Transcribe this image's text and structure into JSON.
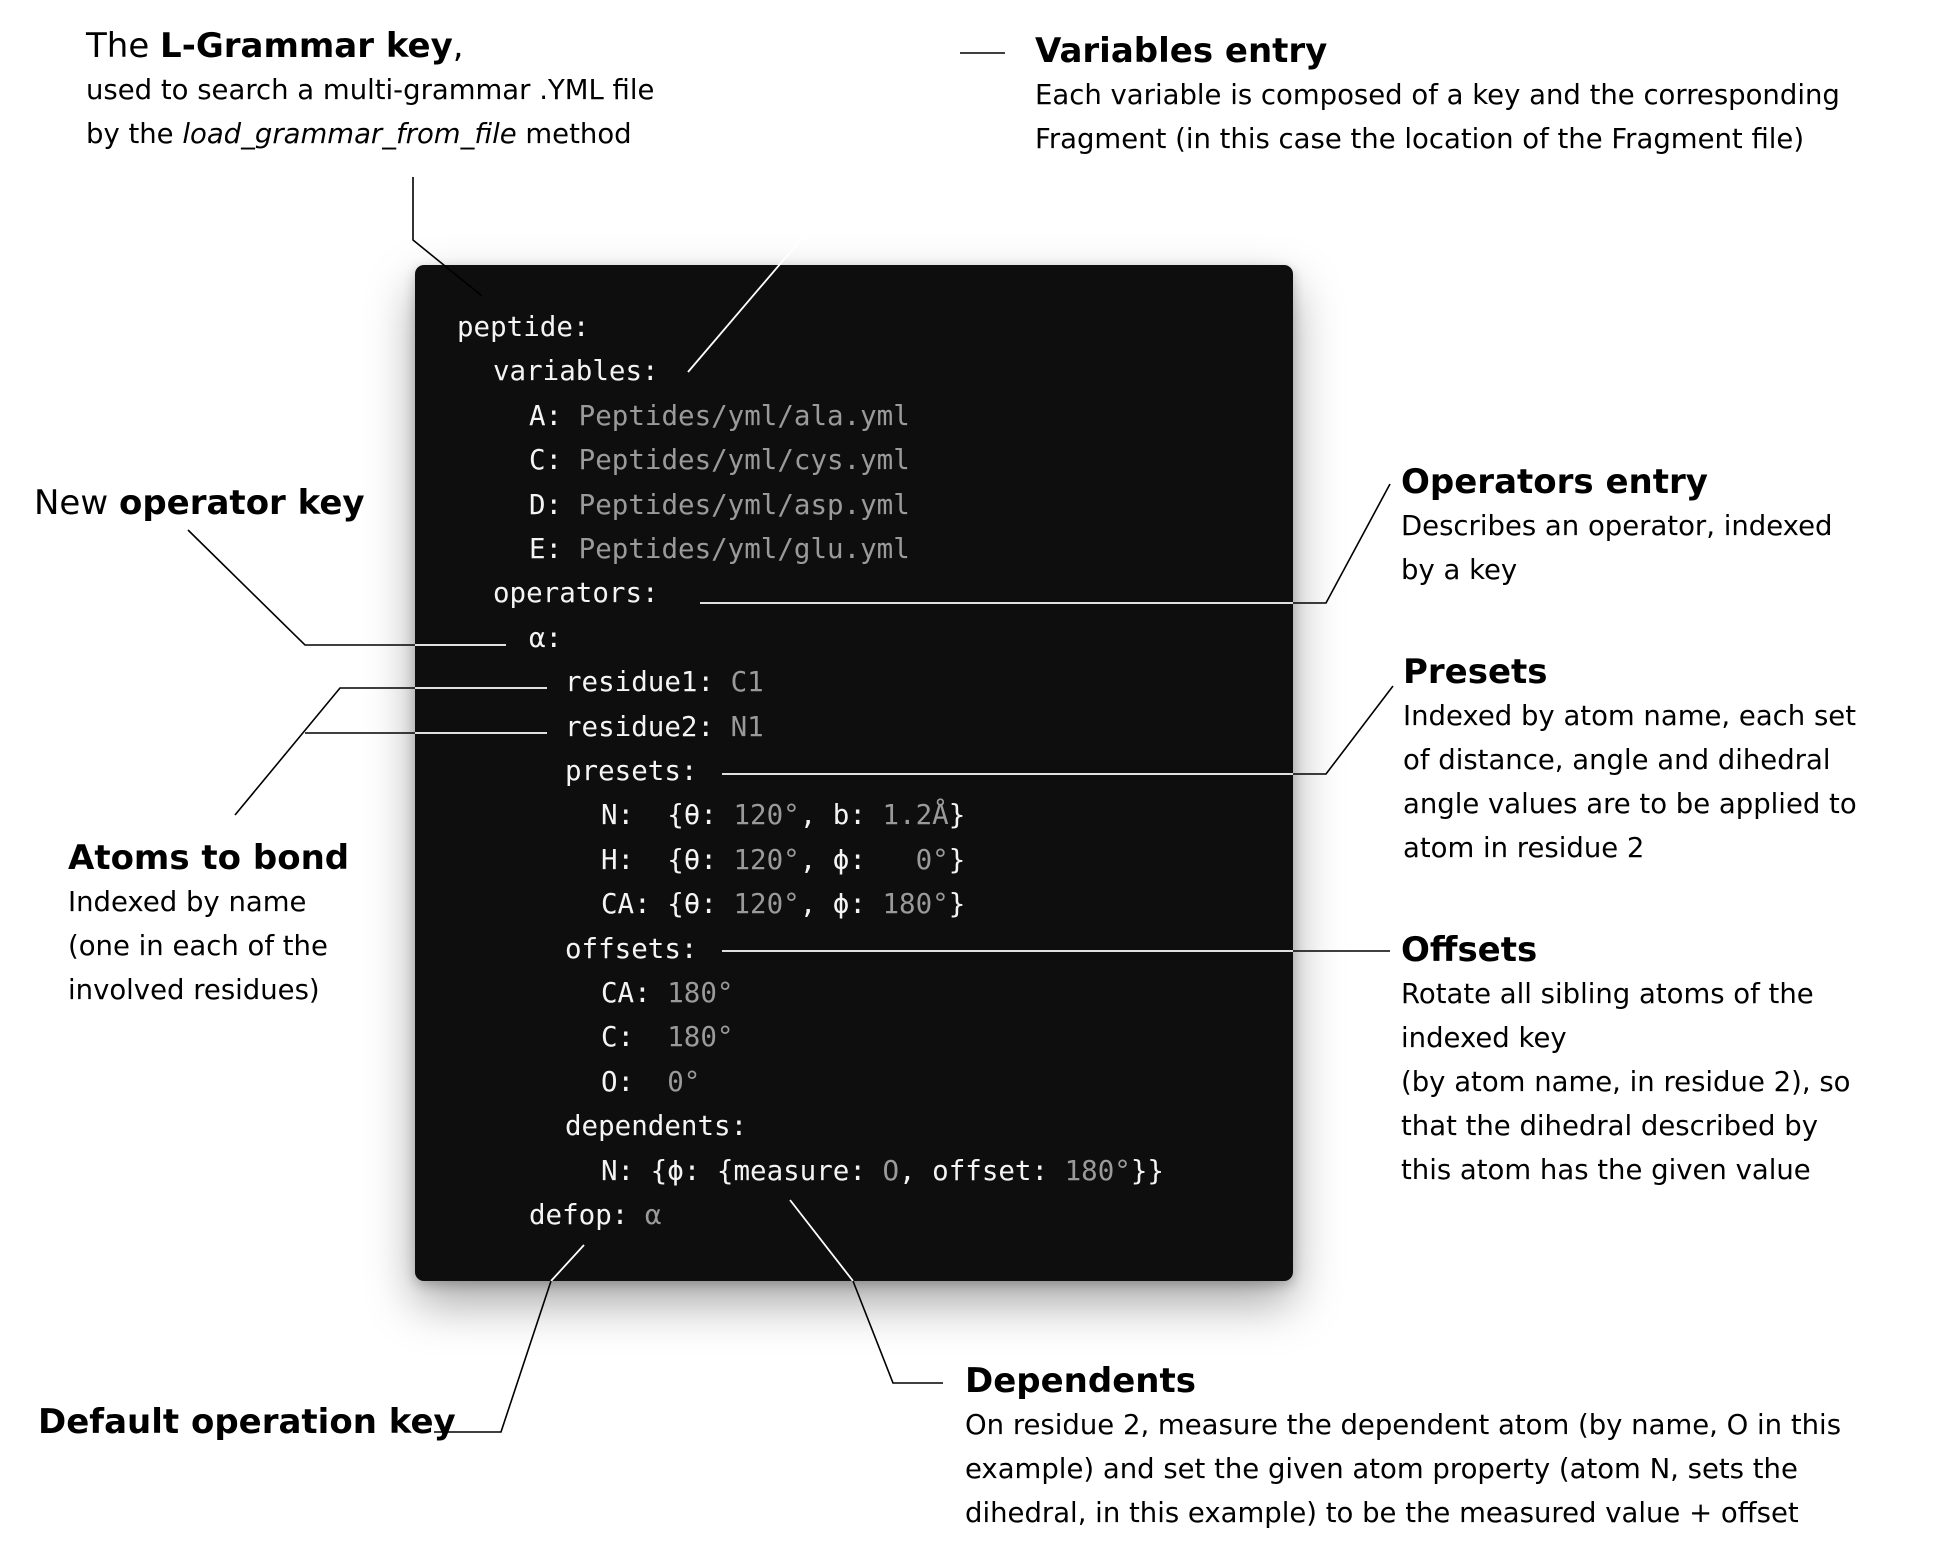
{
  "code": {
    "lines": [
      {
        "indent": 0,
        "key": "peptide:",
        "value": ""
      },
      {
        "indent": 1,
        "key": "variables:",
        "value": ""
      },
      {
        "indent": 2,
        "key": "A: ",
        "value": "Peptides/yml/ala.yml"
      },
      {
        "indent": 2,
        "key": "C: ",
        "value": "Peptides/yml/cys.yml"
      },
      {
        "indent": 2,
        "key": "D: ",
        "value": "Peptides/yml/asp.yml"
      },
      {
        "indent": 2,
        "key": "E: ",
        "value": "Peptides/yml/glu.yml"
      },
      {
        "indent": 1,
        "key": "operators:",
        "value": ""
      },
      {
        "indent": 2,
        "key": "α:",
        "value": ""
      },
      {
        "indent": 3,
        "key": "residue1: ",
        "value": "C1"
      },
      {
        "indent": 3,
        "key": "residue2: ",
        "value": "N1"
      },
      {
        "indent": 3,
        "key": "presets:",
        "value": ""
      },
      {
        "indent": 4,
        "segments": [
          [
            "k",
            "N:  {θ: "
          ],
          [
            "v",
            "120°"
          ],
          [
            "k",
            ", b: "
          ],
          [
            "v",
            "1.2Å"
          ],
          [
            "k",
            "}"
          ]
        ]
      },
      {
        "indent": 4,
        "segments": [
          [
            "k",
            "H:  {θ: "
          ],
          [
            "v",
            "120°"
          ],
          [
            "k",
            ", ϕ: "
          ],
          [
            "v",
            "  0°"
          ],
          [
            "k",
            "}"
          ]
        ]
      },
      {
        "indent": 4,
        "segments": [
          [
            "k",
            "CA: {θ: "
          ],
          [
            "v",
            "120°"
          ],
          [
            "k",
            ", ϕ: "
          ],
          [
            "v",
            "180°"
          ],
          [
            "k",
            "}"
          ]
        ]
      },
      {
        "indent": 3,
        "key": "offsets:",
        "value": ""
      },
      {
        "indent": 4,
        "key": "CA: ",
        "value": "180°"
      },
      {
        "indent": 4,
        "key": "C:  ",
        "value": "180°"
      },
      {
        "indent": 4,
        "key": "O:  ",
        "value": "0°"
      },
      {
        "indent": 3,
        "key": "dependents:",
        "value": ""
      },
      {
        "indent": 4,
        "segments": [
          [
            "k",
            "N: {ϕ: {measure: "
          ],
          [
            "v",
            "O"
          ],
          [
            "k",
            ", offset: "
          ],
          [
            "v",
            "180°"
          ],
          [
            "k",
            "}}"
          ]
        ]
      },
      {
        "indent": 2,
        "key": "defop: ",
        "value": "α"
      }
    ]
  },
  "callouts": {
    "grammar_key": {
      "title_prefix": "The ",
      "title_bold": "L-Grammar key",
      "title_suffix": ",",
      "line1": "used to search a multi-grammar .YML file",
      "line2_prefix": "by the ",
      "line2_italic": "load_grammar_from_file",
      "line2_suffix": "  method"
    },
    "variables_entry": {
      "title": "Variables entry",
      "lines": [
        "Each variable is composed of a key and the corresponding",
        "Fragment (in this case the location of the Fragment file)"
      ]
    },
    "operator_key": {
      "title_prefix": "New ",
      "title_bold": "operator key"
    },
    "operators_entry": {
      "title": "Operators entry",
      "lines": [
        "Describes an operator, indexed",
        "by a key"
      ]
    },
    "presets": {
      "title": "Presets",
      "lines": [
        "Indexed by atom name, each set",
        "of distance, angle and dihedral",
        "angle values are to be applied to",
        "atom in residue 2"
      ]
    },
    "atoms_to_bond": {
      "title": "Atoms to bond",
      "lines": [
        "Indexed by name",
        "(one in each of the",
        "involved residues)"
      ]
    },
    "offsets": {
      "title": "Offsets",
      "lines": [
        "Rotate all sibling atoms of the",
        "indexed key",
        "(by atom name, in residue 2), so",
        "that the dihedral described by",
        "this atom has the given value"
      ]
    },
    "default_operation_key": {
      "title": "Default operation key"
    },
    "dependents": {
      "title": "Dependents",
      "lines": [
        "On residue 2, measure the dependent atom (by name, O in this",
        "example) and set the given atom property (atom N, sets the",
        "dihedral, in this example) to be the measured value + offset"
      ]
    }
  }
}
